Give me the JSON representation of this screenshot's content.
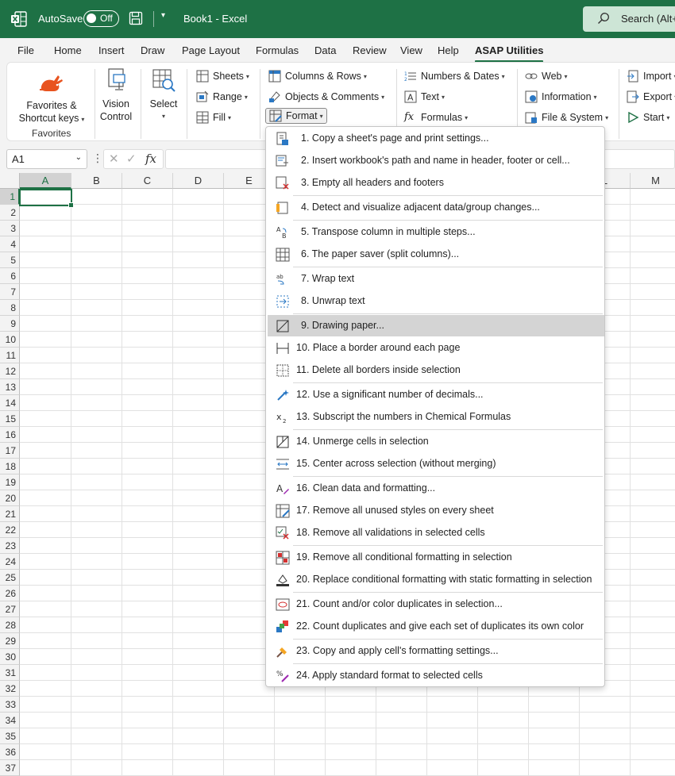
{
  "titlebar": {
    "autosave_label": "AutoSave",
    "autosave_state": "Off",
    "doc_title": "Book1  -  Excel",
    "search_text": "Search (Alt+"
  },
  "tabs": [
    "File",
    "Home",
    "Insert",
    "Draw",
    "Page Layout",
    "Formulas",
    "Data",
    "Review",
    "View",
    "Help",
    "ASAP Utilities"
  ],
  "ribbon": {
    "favorites_btn": [
      "Favorites &",
      "Shortcut keys"
    ],
    "favorites_group": "Favorites",
    "vision_btn": [
      "Vision",
      "Control"
    ],
    "select_btn": "Select",
    "sheets": "Sheets",
    "range": "Range",
    "fill": "Fill",
    "columns_rows": "Columns & Rows",
    "objects_comments": "Objects & Comments",
    "format": "Format",
    "numbers_dates": "Numbers & Dates",
    "text": "Text",
    "formulas": "Formulas",
    "web": "Web",
    "information": "Information",
    "file_system": "File & System",
    "import": "Import",
    "export": "Export",
    "start": "Start"
  },
  "formula_bar": {
    "name_box": "A1",
    "fx": "fx"
  },
  "grid": {
    "columns": [
      "A",
      "B",
      "C",
      "D",
      "E",
      "L",
      "M"
    ],
    "rows": [
      "1",
      "2",
      "3",
      "4",
      "5",
      "6",
      "7",
      "8",
      "9",
      "10",
      "11",
      "12",
      "13",
      "14",
      "15",
      "16",
      "17",
      "18",
      "19",
      "20",
      "21",
      "22",
      "23",
      "24",
      "25",
      "26",
      "27",
      "28",
      "29",
      "30",
      "31",
      "32",
      "33",
      "34",
      "35",
      "36",
      "37"
    ]
  },
  "menu": {
    "items": [
      {
        "label": "1. Copy a sheet's page and print settings...",
        "icon": "page-settings-icon"
      },
      {
        "label": "2. Insert workbook's path and name in header, footer or cell...",
        "icon": "insert-path-icon"
      },
      {
        "label": "3. Empty all headers and footers",
        "icon": "empty-headers-icon"
      },
      {
        "label": "4. Detect and visualize adjacent data/group changes...",
        "icon": "detect-changes-icon"
      },
      {
        "label": "5. Transpose column in multiple steps...",
        "icon": "transpose-icon"
      },
      {
        "label": "6. The paper saver (split columns)...",
        "icon": "paper-saver-icon"
      },
      {
        "label": "7. Wrap text",
        "icon": "wrap-text-icon"
      },
      {
        "label": "8. Unwrap text",
        "icon": "unwrap-text-icon"
      },
      {
        "label": "9. Drawing paper...",
        "icon": "drawing-paper-icon"
      },
      {
        "label": "10. Place a border around each page",
        "icon": "page-border-icon"
      },
      {
        "label": "11. Delete all borders inside selection",
        "icon": "delete-borders-icon"
      },
      {
        "label": "12. Use a significant number of decimals...",
        "icon": "decimals-icon"
      },
      {
        "label": "13. Subscript the numbers in Chemical Formulas",
        "icon": "subscript-icon"
      },
      {
        "label": "14. Unmerge cells in selection",
        "icon": "unmerge-icon"
      },
      {
        "label": "15. Center across selection (without merging)",
        "icon": "center-across-icon"
      },
      {
        "label": "16. Clean data and formatting...",
        "icon": "clean-data-icon"
      },
      {
        "label": "17. Remove all unused styles on every sheet",
        "icon": "remove-styles-icon"
      },
      {
        "label": "18. Remove all validations in selected cells",
        "icon": "remove-validations-icon"
      },
      {
        "label": "19. Remove all conditional formatting in selection",
        "icon": "remove-cf-icon"
      },
      {
        "label": "20. Replace conditional formatting with static formatting in selection",
        "icon": "replace-cf-icon"
      },
      {
        "label": "21. Count and/or color duplicates in selection...",
        "icon": "count-duplicates-icon"
      },
      {
        "label": "22. Count duplicates and give each set of duplicates its own color",
        "icon": "color-duplicates-icon"
      },
      {
        "label": "23. Copy and apply cell's formatting settings...",
        "icon": "format-painter-icon"
      },
      {
        "label": "24. Apply standard format to selected cells",
        "icon": "standard-format-icon"
      }
    ]
  },
  "colors": {
    "excel_green": "#1e7145",
    "ribbon_bg": "#f3f3f3",
    "hover": "#d4d4d4"
  }
}
